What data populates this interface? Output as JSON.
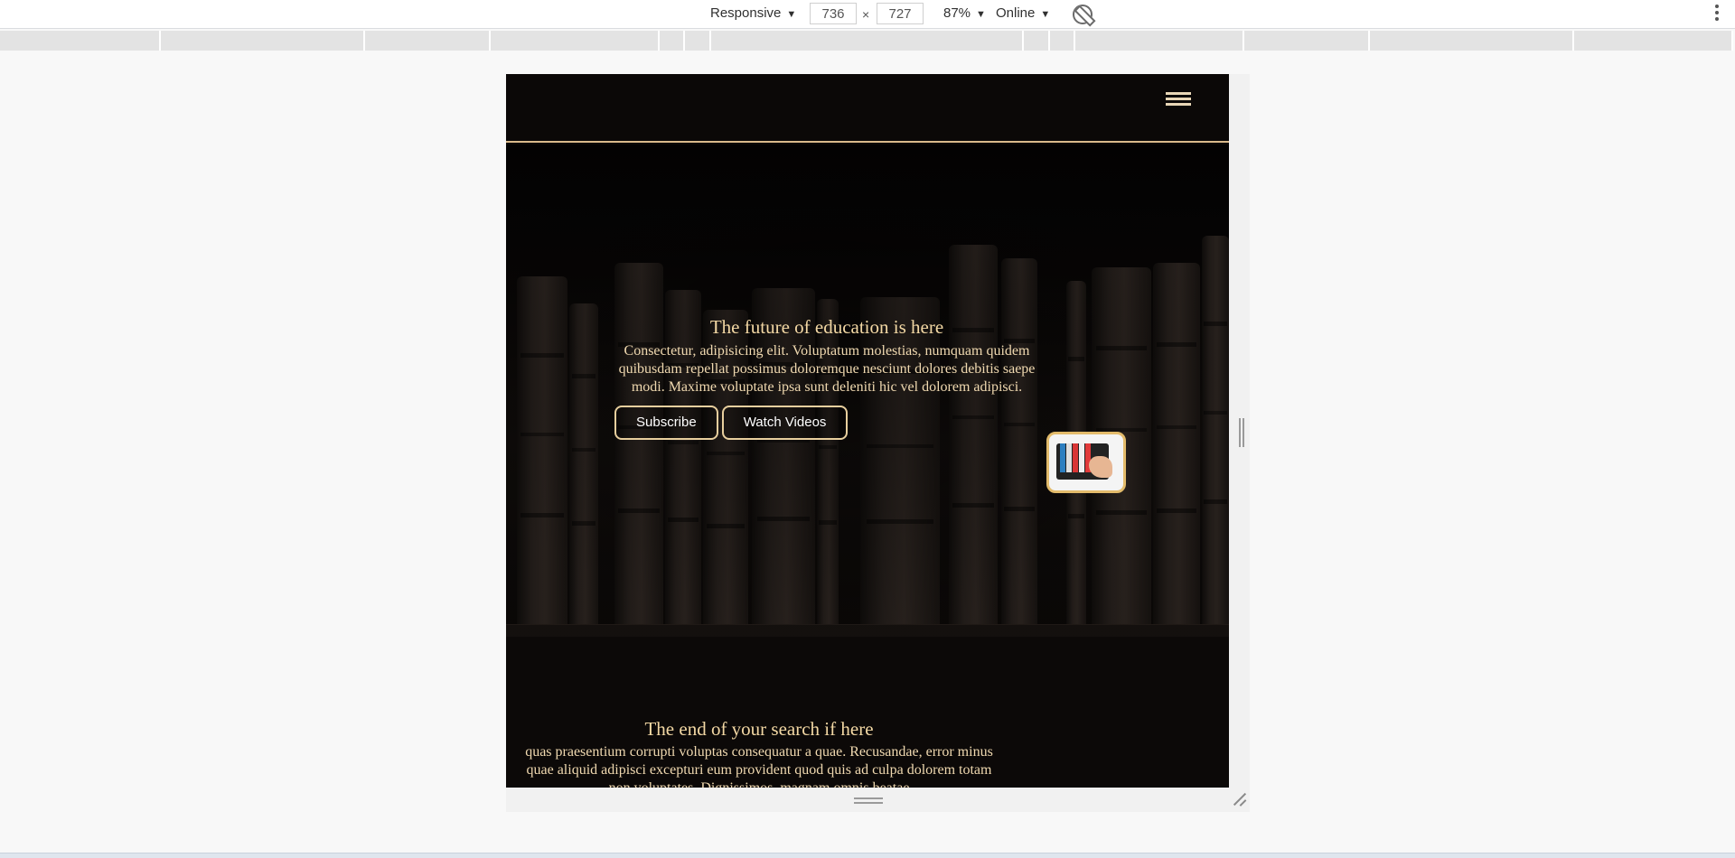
{
  "devtools": {
    "device": "Responsive",
    "width": "736",
    "height": "727",
    "times": "×",
    "zoom": "87%",
    "network": "Online",
    "caret": "▼"
  },
  "site": {
    "hero": {
      "title": "The future of education is here",
      "text": "Consectetur, adipisicing elit. Voluptatum molestias, numquam quidem quibusdam repellat possimus doloremque nesciunt dolores debitis saepe modi. Maxime voluptate ipsa sunt deleniti hic vel dolorem adipisci.",
      "buttons": {
        "subscribe": "Subscribe",
        "watch": "Watch Videos"
      }
    },
    "section2": {
      "title": "The end of your search if here",
      "text": "quas praesentium corrupti voluptas consequatur a quae. Recusandae, error minus quae aliquid adipisci excepturi eum provident quod quis ad culpa dolorem totam non voluptates. Dignissimos, magnam omnis beatae"
    }
  },
  "colors": {
    "accent": "#d9b98a",
    "text": "#f0d9b0",
    "background": "#0c0908",
    "thumb_border": "#e3bb6b"
  }
}
